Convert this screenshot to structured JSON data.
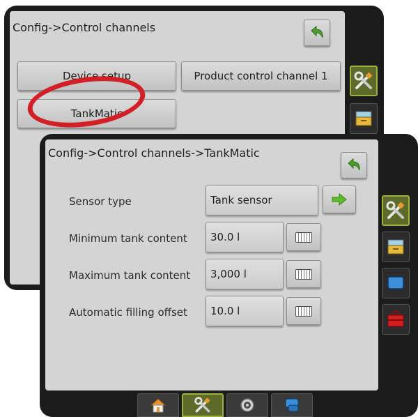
{
  "screen_a": {
    "title": "Config->Control channels",
    "buttons": {
      "device_setup": "Device setup",
      "product_control": "Product control channel 1",
      "tankmatic": "TankMatic"
    }
  },
  "screen_b": {
    "title": "Config->Control channels->TankMatic",
    "rows": [
      {
        "label": "Sensor type",
        "value": "Tank sensor",
        "action": "arrow-right-icon"
      },
      {
        "label": "Minimum tank content",
        "value": "30.0 l",
        "action": "keyboard-icon"
      },
      {
        "label": "Maximum tank content",
        "value": "3,000 l",
        "action": "keyboard-icon"
      },
      {
        "label": "Automatic filling offset",
        "value": "10.0 l",
        "action": "keyboard-icon"
      }
    ]
  },
  "colors": {
    "highlight_ellipse": "#d32027",
    "active_tab": "#5c6b2a",
    "back_arrow": "#4aa02c",
    "next_arrow": "#5cbf2a"
  },
  "icons": {
    "side_tabs_a": [
      "tools-icon",
      "storage-icon"
    ],
    "side_tabs_b": [
      "tools-icon",
      "storage-icon",
      "display-icon",
      "toolbox-icon"
    ],
    "bottom_tabs": [
      "home-icon",
      "tools-icon",
      "gps-icon",
      "guidance-icon"
    ]
  }
}
